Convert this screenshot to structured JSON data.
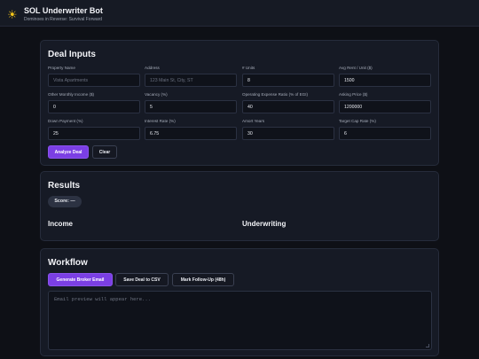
{
  "header": {
    "icon": "sun-icon",
    "title": "SOL Underwriter Bot",
    "subtitle": "Dominoes in Reverse: Survival Forward"
  },
  "deal_inputs": {
    "title": "Deal Inputs",
    "fields": [
      {
        "label": "Property Name",
        "value": "",
        "placeholder": "Vista Apartments"
      },
      {
        "label": "Address",
        "value": "",
        "placeholder": "123 Main St, City, ST"
      },
      {
        "label": "# Units",
        "value": "8",
        "placeholder": ""
      },
      {
        "label": "Avg Rent / Unit ($)",
        "value": "1500",
        "placeholder": ""
      },
      {
        "label": "Other Monthly Income ($)",
        "value": "0",
        "placeholder": ""
      },
      {
        "label": "Vacancy (%)",
        "value": "5",
        "placeholder": ""
      },
      {
        "label": "Operating Expense Ratio (% of EGI)",
        "value": "40",
        "placeholder": ""
      },
      {
        "label": "Asking Price ($)",
        "value": "1200000",
        "placeholder": ""
      },
      {
        "label": "Down Payment (%)",
        "value": "25",
        "placeholder": ""
      },
      {
        "label": "Interest Rate (%)",
        "value": "6.75",
        "placeholder": ""
      },
      {
        "label": "Amort Years",
        "value": "30",
        "placeholder": ""
      },
      {
        "label": "Target Cap Rate (%)",
        "value": "6",
        "placeholder": ""
      }
    ],
    "analyze_label": "Analyze Deal",
    "clear_label": "Clear"
  },
  "results": {
    "title": "Results",
    "score_label": "Score: —",
    "income_heading": "Income",
    "underwriting_heading": "Underwriting"
  },
  "workflow": {
    "title": "Workflow",
    "email_button": "Generate Broker Email",
    "csv_button": "Save Deal to CSV",
    "followup_button": "Mark Follow-Up (48h)",
    "email_placeholder": "Email preview will appear here..."
  },
  "colors": {
    "background": "#0e1016",
    "card": "#161a25",
    "accent": "#7b3fe4",
    "sun": "#f5c518"
  }
}
